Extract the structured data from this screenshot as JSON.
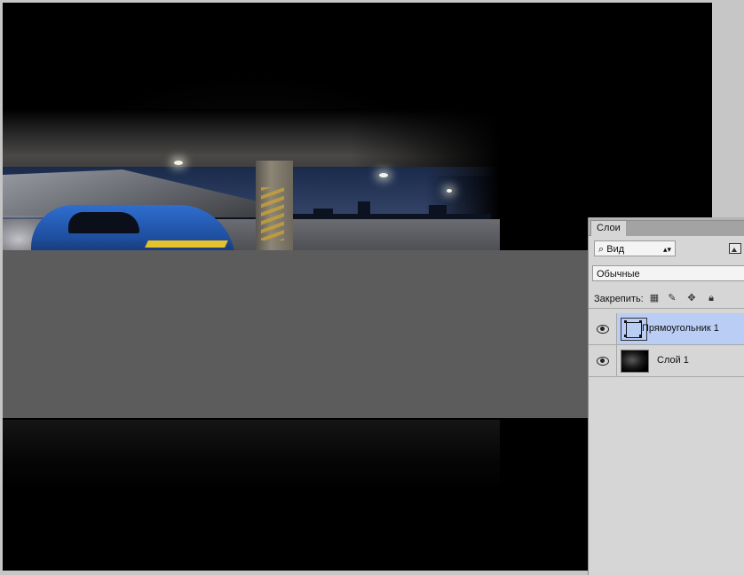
{
  "panel": {
    "tab_label": "Слои",
    "filter": {
      "selected": "Вид",
      "icon": "search-icon"
    },
    "blend_mode": "Обычные",
    "lock_label": "Закрепить:",
    "lock_icons": [
      "lock-transparent-icon",
      "brush-icon",
      "move-icon",
      "lock-icon"
    ],
    "layers": [
      {
        "name": "Прямоугольник 1",
        "type": "shape",
        "visible": true,
        "selected": true
      },
      {
        "name": "Слой 1",
        "type": "raster",
        "visible": true,
        "selected": false
      }
    ]
  },
  "colors": {
    "panel_bg": "#d6d6d6",
    "selected_layer": "#b9cdf5",
    "rectangle_fill": "#5c5c5c",
    "workspace": "#c6c6c6"
  }
}
